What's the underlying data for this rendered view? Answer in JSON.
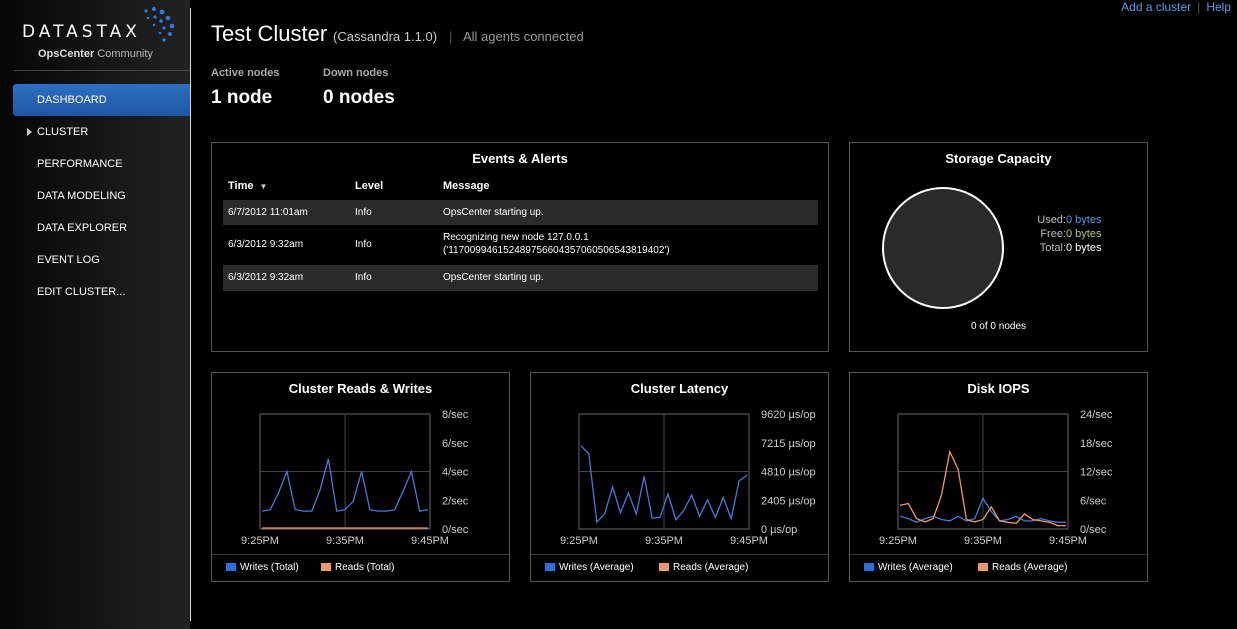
{
  "brand": {
    "logo_text": "DATASTAX",
    "product": "OpsCenter",
    "edition": "Community"
  },
  "top_links": {
    "add_cluster": "Add a cluster",
    "help": "Help",
    "separator": "|"
  },
  "sidebar": {
    "items": [
      {
        "label": "DASHBOARD",
        "active": true
      },
      {
        "label": "CLUSTER",
        "expandable": true
      },
      {
        "label": "PERFORMANCE"
      },
      {
        "label": "DATA MODELING"
      },
      {
        "label": "DATA EXPLORER"
      },
      {
        "label": "EVENT LOG"
      },
      {
        "label": "EDIT CLUSTER..."
      }
    ]
  },
  "header": {
    "title": "Test Cluster",
    "version": "(Cassandra 1.1.0)",
    "separator": "|",
    "agents_status": "All agents connected",
    "active_nodes_label": "Active nodes",
    "active_nodes_value": "1 node",
    "down_nodes_label": "Down nodes",
    "down_nodes_value": "0 nodes"
  },
  "events": {
    "title": "Events & Alerts",
    "columns": {
      "time": "Time",
      "level": "Level",
      "message": "Message"
    },
    "rows": [
      {
        "time": "6/7/2012 11:01am",
        "level": "Info",
        "message": "OpsCenter starting up."
      },
      {
        "time": "6/3/2012 9:32am",
        "level": "Info",
        "message": "Recognizing new node 127.0.0.1",
        "message2": "('117009946152489756604357060506543819402')"
      },
      {
        "time": "6/3/2012 9:32am",
        "level": "Info",
        "message": "OpsCenter starting up."
      }
    ]
  },
  "storage": {
    "title": "Storage Capacity",
    "used_label": "Used:",
    "used_value": "0 bytes",
    "free_label": "Free:",
    "free_value": "0 bytes",
    "total_label": "Total:",
    "total_value": "0 bytes",
    "nodes_text": "0 of 0 nodes",
    "colors": {
      "used": "#5b9ae6",
      "free": "#b5c98a",
      "total": "#ffffff"
    }
  },
  "charts_meta": {
    "rw": {
      "title": "Cluster Reads & Writes",
      "legend": [
        "Writes (Total)",
        "Reads (Total)"
      ]
    },
    "latency": {
      "title": "Cluster Latency",
      "legend": [
        "Writes (Average)",
        "Reads (Average)"
      ]
    },
    "iops": {
      "title": "Disk IOPS",
      "legend": [
        "Writes (Average)",
        "Reads (Average)"
      ]
    }
  },
  "chart_data": [
    {
      "id": "rw",
      "type": "line",
      "title": "Cluster Reads & Writes",
      "x_ticks": [
        "9:25PM",
        "9:35PM",
        "9:45PM"
      ],
      "y_ticks": [
        "0/sec",
        "2/sec",
        "4/sec",
        "6/sec",
        "8/sec"
      ],
      "ylim": [
        0,
        8
      ],
      "grid": true,
      "legend_position": "bottom",
      "series": [
        {
          "name": "Writes (Total)",
          "color": "#4a78d8",
          "values": [
            1.2,
            1.3,
            2.5,
            4.0,
            1.3,
            1.2,
            1.2,
            2.7,
            4.9,
            1.2,
            1.3,
            1.9,
            4.0,
            1.3,
            1.2,
            1.2,
            1.3,
            2.6,
            4.0,
            1.2,
            1.3
          ]
        },
        {
          "name": "Reads (Total)",
          "color": "#f0956c",
          "values": [
            0,
            0,
            0,
            0,
            0,
            0,
            0,
            0,
            0,
            0,
            0,
            0,
            0,
            0,
            0,
            0,
            0,
            0,
            0,
            0,
            0
          ]
        }
      ]
    },
    {
      "id": "latency",
      "type": "line",
      "title": "Cluster Latency",
      "x_ticks": [
        "9:25PM",
        "9:35PM",
        "9:45PM"
      ],
      "y_ticks": [
        "0 µs/op",
        "2405 µs/op",
        "4810 µs/op",
        "7215 µs/op",
        "9620 µs/op"
      ],
      "ylim": [
        0,
        9620
      ],
      "grid": true,
      "legend_position": "bottom",
      "series": [
        {
          "name": "Writes (Average)",
          "color": "#4a78d8",
          "values": [
            7000,
            6300,
            500,
            1200,
            3500,
            1300,
            3000,
            1200,
            4400,
            850,
            900,
            2900,
            700,
            1500,
            2800,
            1000,
            2400,
            900,
            2600,
            800,
            4000,
            4500
          ]
        },
        {
          "name": "Reads (Average)",
          "color": "#f0956c",
          "values": []
        }
      ]
    },
    {
      "id": "iops",
      "type": "line",
      "title": "Disk IOPS",
      "x_ticks": [
        "9:25PM",
        "9:35PM",
        "9:45PM"
      ],
      "y_ticks": [
        "0/sec",
        "6/sec",
        "12/sec",
        "18/sec",
        "24/sec"
      ],
      "ylim": [
        0,
        24
      ],
      "grid": true,
      "legend_position": "bottom",
      "series": [
        {
          "name": "Writes (Average)",
          "color": "#4a78d8",
          "values": [
            2.5,
            2.0,
            1.2,
            2.0,
            2.5,
            1.8,
            1.5,
            2.5,
            1.5,
            2.0,
            6.3,
            3.5,
            1.5,
            1.8,
            2.5,
            1.5,
            1.5,
            2.0,
            1.5,
            1.2,
            1.2
          ]
        },
        {
          "name": "Reads (Average)",
          "color": "#f0956c",
          "values": [
            4.8,
            5.2,
            2.0,
            1.3,
            2.0,
            7.0,
            16.2,
            12.5,
            1.8,
            1.3,
            1.8,
            4.5,
            1.5,
            1.2,
            1.0,
            3.0,
            1.8,
            1.5,
            1.2,
            0.5,
            0.5
          ]
        }
      ]
    }
  ]
}
